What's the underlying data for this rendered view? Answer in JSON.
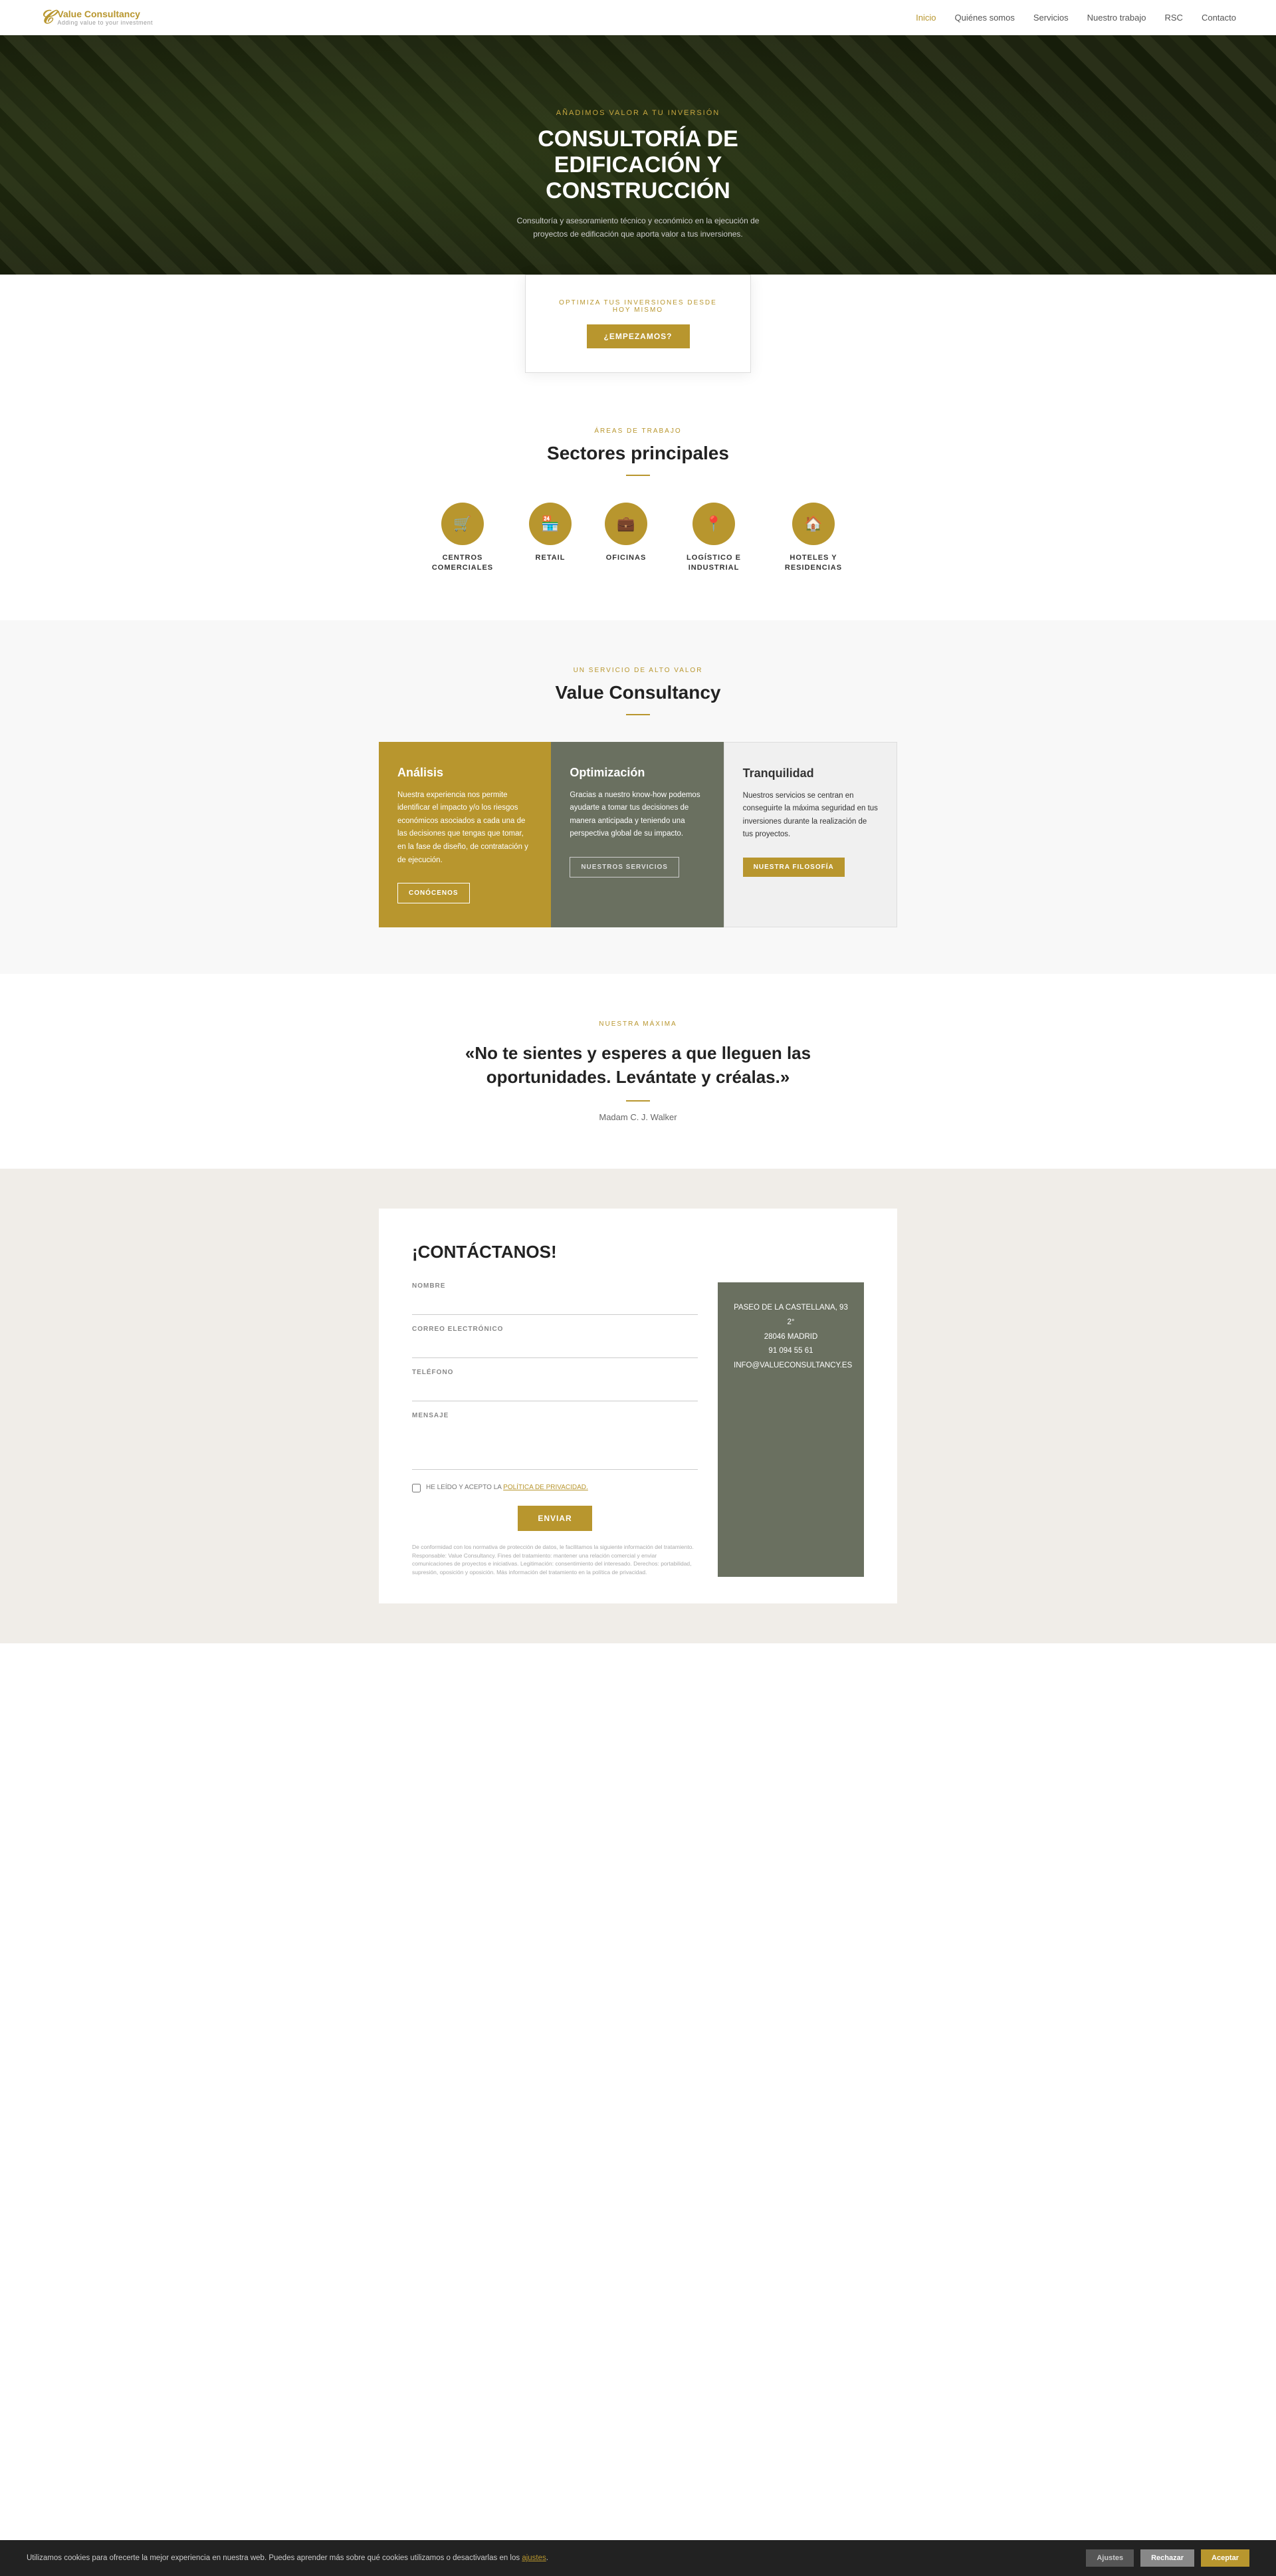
{
  "site": {
    "logo_icon": "C",
    "logo_name_plain": "Value ",
    "logo_name_accent": "Consultancy",
    "logo_tagline": "Adding value to your investment"
  },
  "nav": {
    "links": [
      {
        "label": "Inicio",
        "active": true
      },
      {
        "label": "Quiénes somos",
        "active": false
      },
      {
        "label": "Servicios",
        "active": false
      },
      {
        "label": "Nuestro trabajo",
        "active": false
      },
      {
        "label": "RSC",
        "active": false
      },
      {
        "label": "Contacto",
        "active": false
      }
    ]
  },
  "hero": {
    "eyebrow": "AÑADIMOS VALOR A TU INVERSIÓN",
    "title": "CONSULTORÍA DE EDIFICACIÓN Y CONSTRUCCIÓN",
    "description": "Consultoría y asesoramiento técnico y económico en la ejecución de proyectos de edificación que aporta valor a tus inversiones."
  },
  "cta_card": {
    "eyebrow": "OPTIMIZA TUS INVERSIONES DESDE HOY MISMO",
    "button_label": "¿EMPEZAMOS?"
  },
  "sectors": {
    "eyebrow": "ÁREAS DE TRABAJO",
    "title": "Sectores principales",
    "items": [
      {
        "label": "CENTROS COMERCIALES",
        "icon": "🛒"
      },
      {
        "label": "RETAIL",
        "icon": "🏪"
      },
      {
        "label": "OFICINAS",
        "icon": "💼"
      },
      {
        "label": "LOGÍSTICO E INDUSTRIAL",
        "icon": "📍"
      },
      {
        "label": "HOTELES Y RESIDENCIAS",
        "icon": "🏠"
      }
    ]
  },
  "value_section": {
    "eyebrow": "UN SERVICIO DE ALTO VALOR",
    "title": "Value Consultancy",
    "cards": [
      {
        "type": "gold",
        "title": "Análisis",
        "text": "Nuestra experiencia nos permite identificar el impacto y/o los riesgos económicos asociados a cada una de las decisiones que tengas que tomar, en la fase de diseño, de contratación y de ejecución.",
        "button_label": "CONÓCENOS",
        "button_type": "outline-white"
      },
      {
        "type": "dark",
        "title": "Optimización",
        "text": "Gracias a nuestro know-how podemos ayudarte a tomar tus decisiones de manera anticipada y teniendo una perspectiva global de su impacto.",
        "button_label": "NUESTROS SERVICIOS",
        "button_type": "outline-dark"
      },
      {
        "type": "light",
        "title": "Tranquilidad",
        "text": "Nuestros servicios se centran en conseguirte la máxima seguridad en tus inversiones durante la realización de tus proyectos.",
        "button_label": "NUESTRA FILOSOFÍA",
        "button_type": "gold-btn"
      }
    ]
  },
  "quote_section": {
    "eyebrow": "NUESTRA MÁXIMA",
    "text": "«No te sientes y esperes a que lleguen las oportunidades. Levántate y créalas.»",
    "author": "Madam C. J. Walker"
  },
  "contact_section": {
    "title": "¡CONTÁCTANOS!",
    "fields": {
      "name_label": "NOMBRE",
      "email_label": "CORREO ELECTRÓNICO",
      "phone_label": "TELÉFONO",
      "message_label": "MENSAJE"
    },
    "privacy_text": "HE LEÍDO Y ACEPTO LA ",
    "privacy_link": "POLÍTICA DE PRIVACIDAD.",
    "submit_label": "ENVIAR",
    "address": {
      "street": "PASEO DE LA CASTELLANA, 93 2°",
      "city": "28046 MADRID",
      "phone": "91 094 55 61",
      "email": "INFO@VALUECONSULTANCY.ES"
    },
    "legal": "De conformidad con los normativa de protección de datos, le facilitamos la siguiente información del tratamiento. Responsable: Value Consultancy. Fines del tratamiento: mantener una relación comercial y enviar comunicaciones de proyectos e iniciativas. Legitimación: consentimiento del interesado. Derechos: portabilidad, supresión, oposición y oposición. Más información del tratamiento en la política de privacidad."
  },
  "cookie_bar": {
    "text": "Utilizamos cookies para ofrecerte la mejor experiencia en nuestra web. Puedes aprender más sobre qué cookies utilizamos o desactivarlas en los ",
    "link_text": "ajustes",
    "btn_settings": "Ajustes",
    "btn_reject": "Rechazar",
    "btn_accept": "Aceptar"
  }
}
